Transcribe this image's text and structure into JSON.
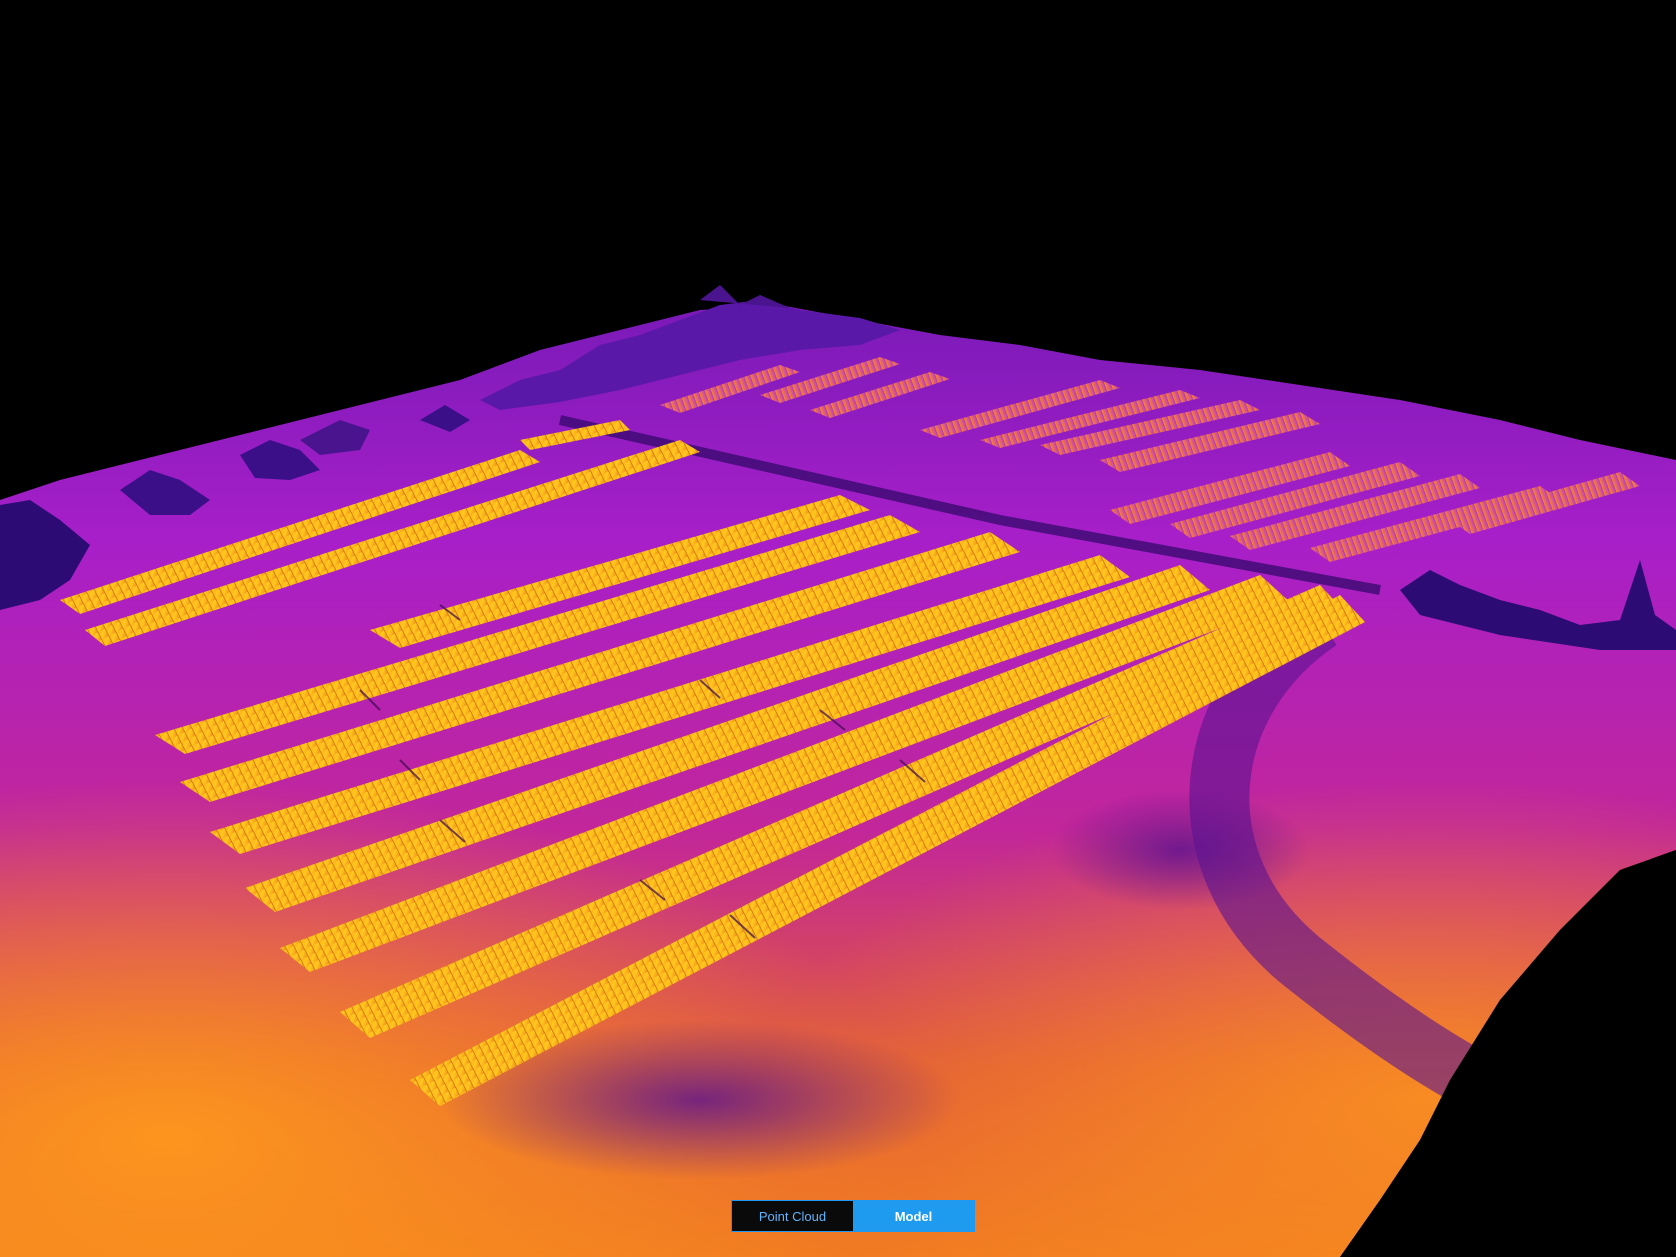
{
  "viewer": {
    "mode": "Model",
    "colors": {
      "background": "#000000",
      "accent": "#1e9bef",
      "thermal_low": "#2a0a6e",
      "thermal_mid": "#b01ad0",
      "thermal_high": "#ff8a1c",
      "thermal_peak": "#ffd21c"
    }
  },
  "view_toggle": {
    "point_cloud_label": "Point Cloud",
    "model_label": "Model",
    "selected": "Model"
  }
}
